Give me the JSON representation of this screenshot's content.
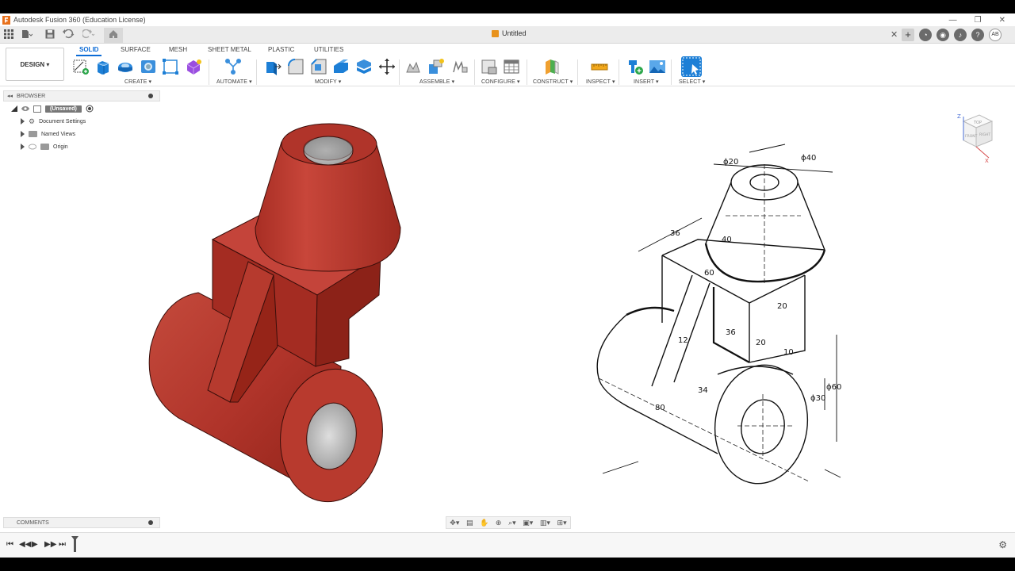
{
  "window": {
    "title": "Autodesk Fusion 360 (Education License)",
    "controls": [
      "—",
      "❐",
      "✕"
    ]
  },
  "document": {
    "tab_name": "Untitled"
  },
  "user": {
    "initials": "AB"
  },
  "workspace": {
    "label": "DESIGN ▾"
  },
  "tabs": [
    "SOLID",
    "SURFACE",
    "MESH",
    "SHEET METAL",
    "PLASTIC",
    "UTILITIES"
  ],
  "groups": {
    "create": "CREATE ▾",
    "automate": "AUTOMATE ▾",
    "modify": "MODIFY ▾",
    "assemble": "ASSEMBLE ▾",
    "configure": "CONFIGURE ▾",
    "construct": "CONSTRUCT ▾",
    "inspect": "INSPECT ▾",
    "insert": "INSERT ▾",
    "select": "SELECT ▾"
  },
  "browser": {
    "title": "BROWSER",
    "root": "(Unsaved)",
    "items": [
      "Document Settings",
      "Named Views",
      "Origin"
    ]
  },
  "comments": {
    "title": "COMMENTS"
  },
  "viewcube": {
    "faces": [
      "TOP",
      "FRONT",
      "RIGHT"
    ],
    "axes": [
      "Z",
      "X"
    ]
  },
  "drawing": {
    "dims": [
      "ϕ20",
      "ϕ40",
      "36",
      "40",
      "60",
      "12",
      "36",
      "20",
      "20",
      "10",
      "34",
      "80",
      "ϕ30",
      "ϕ60"
    ]
  },
  "colors": {
    "part_red": "#b0342a",
    "accent_blue": "#0b6bd6"
  }
}
